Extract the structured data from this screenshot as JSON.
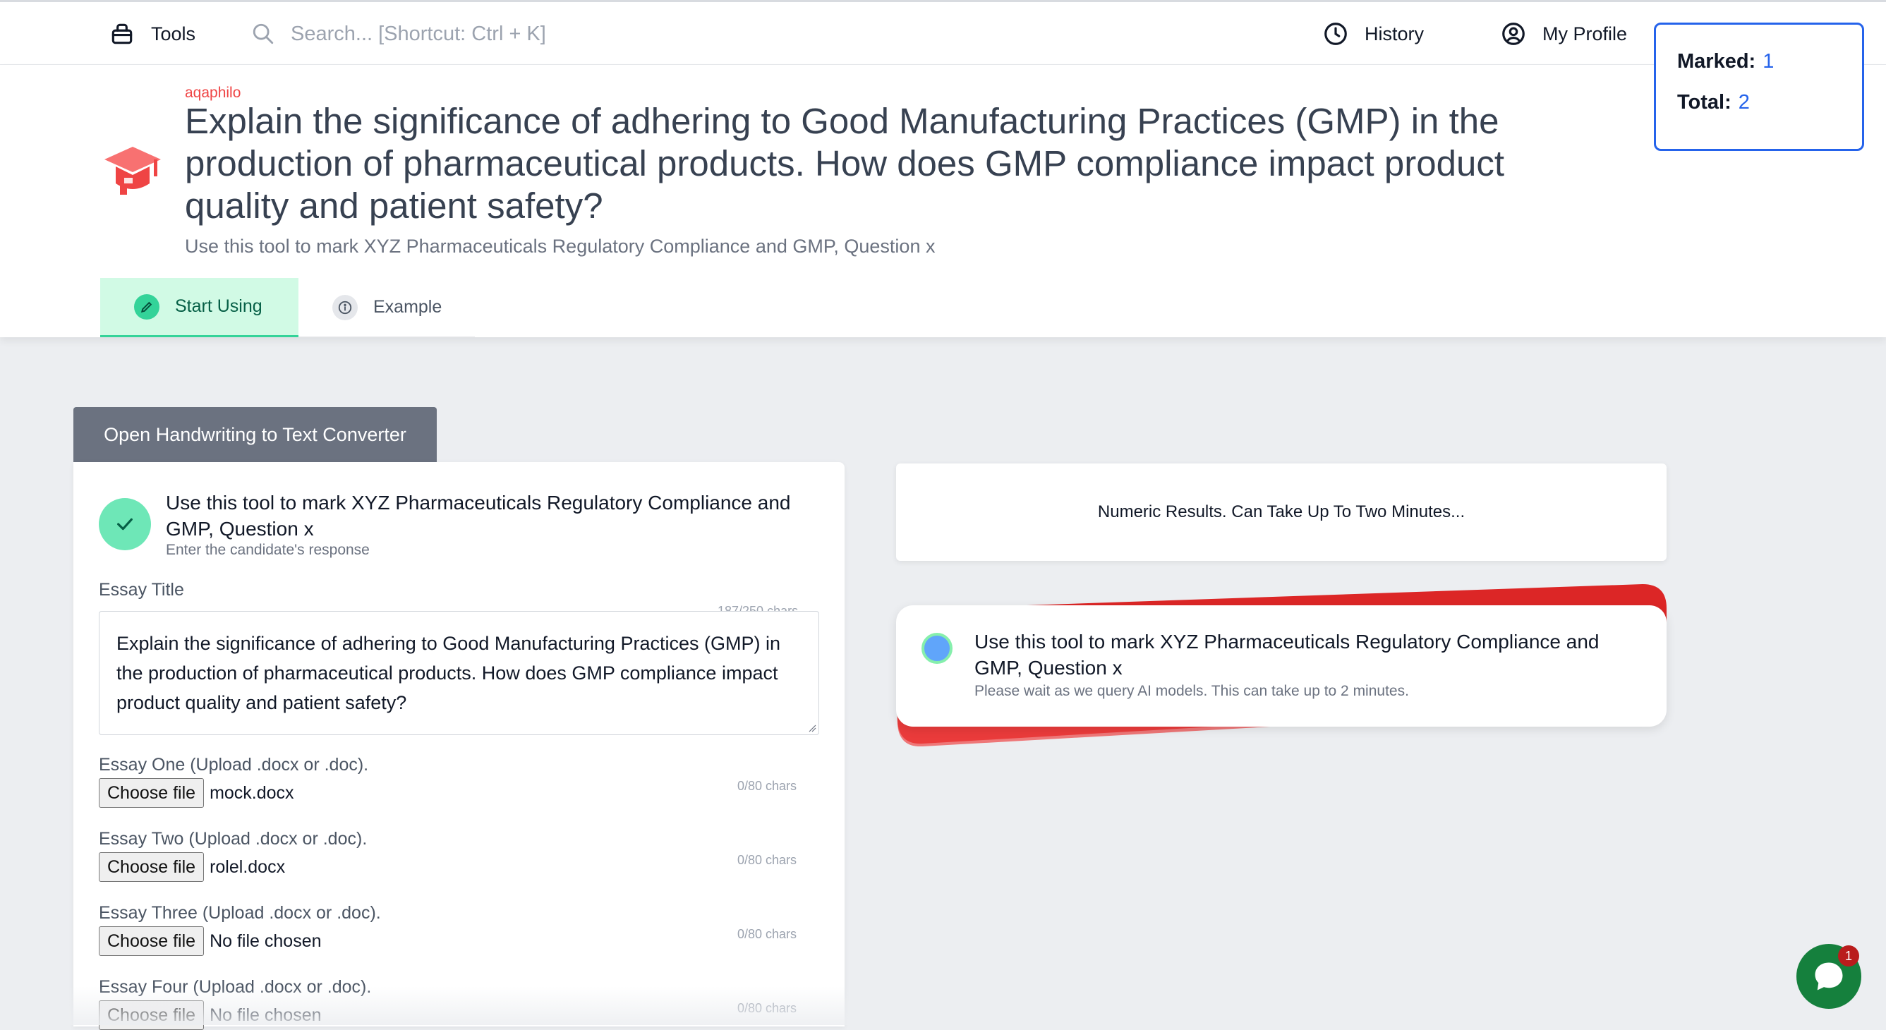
{
  "nav": {
    "tools_label": "Tools",
    "search_placeholder": "Search... [Shortcut: Ctrl + K]",
    "history_label": "History",
    "profile_label": "My Profile"
  },
  "counts": {
    "marked_label": "Marked:",
    "marked_value": "1",
    "total_label": "Total:",
    "total_value": "2"
  },
  "header": {
    "brand": "aqaphilo",
    "title": "Explain the significance of adhering to Good Manufacturing Practices (GMP) in the production of pharmaceutical products. How does GMP compliance impact product quality and patient safety?",
    "subtitle": "Use this tool to mark XYZ Pharmaceuticals Regulatory Compliance and GMP, Question x"
  },
  "tabs": [
    {
      "label": "Start Using",
      "icon": "pencil-icon",
      "active": true
    },
    {
      "label": "Example",
      "icon": "info-icon",
      "active": false
    }
  ],
  "convert_button": "Open Handwriting to Text Converter",
  "form": {
    "title": "Use this tool to mark XYZ Pharmaceuticals Regulatory Compliance and GMP, Question x",
    "subtitle": "Enter the candidate's response",
    "essay_title_label": "Essay Title",
    "essay_title_counter": "187/250 chars",
    "essay_title_value": "Explain the significance of adhering to Good Manufacturing Practices (GMP) in the production of pharmaceutical products. How does GMP compliance impact product quality and patient safety?",
    "choose_file_label": "Choose file",
    "files": [
      {
        "label": "Essay One (Upload .docx or .doc).",
        "file": "mock.docx",
        "counter": "0/80 chars"
      },
      {
        "label": "Essay Two (Upload .docx or .doc).",
        "file": "rolel.docx",
        "counter": "0/80 chars"
      },
      {
        "label": "Essay Three (Upload .docx or .doc).",
        "file": "No file chosen",
        "counter": "0/80 chars"
      },
      {
        "label": "Essay Four (Upload .docx or .doc).",
        "file": "No file chosen",
        "counter": "0/80 chars"
      }
    ]
  },
  "results": {
    "numeric_text": "Numeric Results. Can Take Up To Two Minutes...",
    "status_title": "Use this tool to mark XYZ Pharmaceuticals Regulatory Compliance and GMP, Question x",
    "status_sub": "Please wait as we query AI models. This can take up to 2 minutes."
  },
  "chat": {
    "badge": "1"
  },
  "colors": {
    "accent_red": "#ef4444",
    "accent_blue": "#2563eb",
    "success_green": "#6ee7b7"
  }
}
